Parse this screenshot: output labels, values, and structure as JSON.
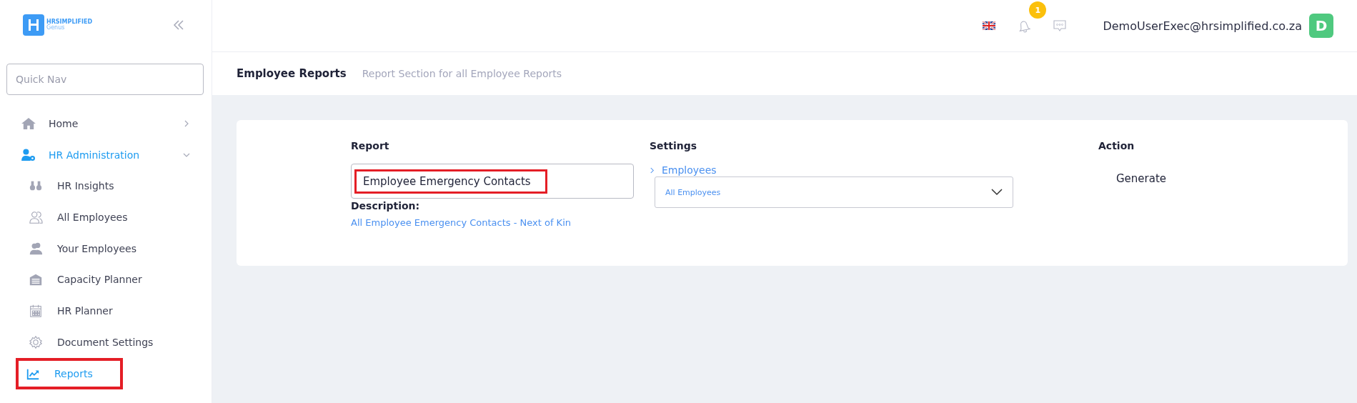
{
  "logo": {
    "brand": "HRSIMPLIFIED",
    "product": "Genus"
  },
  "quick_nav": {
    "placeholder": "Quick Nav"
  },
  "nav": [
    {
      "label": "Home",
      "selected": false,
      "expanded": false,
      "highlighted": false
    },
    {
      "label": "HR Administration",
      "selected": true,
      "expanded": true,
      "highlighted": false,
      "children": [
        {
          "label": "HR Insights",
          "selected": false,
          "highlighted": false
        },
        {
          "label": "All Employees",
          "selected": false,
          "highlighted": false
        },
        {
          "label": "Your Employees",
          "selected": false,
          "highlighted": false
        },
        {
          "label": "Capacity Planner",
          "selected": false,
          "highlighted": false
        },
        {
          "label": "HR Planner",
          "selected": false,
          "highlighted": false
        },
        {
          "label": "Document Settings",
          "selected": false,
          "highlighted": false
        },
        {
          "label": "Reports",
          "selected": true,
          "highlighted": true
        }
      ]
    }
  ],
  "topbar": {
    "notification_count": "1",
    "user_email": "DemoUserExec@hrsimplified.co.za",
    "avatar_letter": "D"
  },
  "page_header": {
    "title": "Employee Reports",
    "subtitle": "Report Section for all Employee Reports"
  },
  "report_form": {
    "report": {
      "heading": "Report",
      "value": "Employee Emergency Contacts",
      "highlighted": true
    },
    "description": {
      "heading": "Description:",
      "text": "All Employee Emergency Contacts - Next of Kin"
    },
    "settings": {
      "heading": "Settings",
      "group": "Employees",
      "select_value": "All Employees"
    },
    "action": {
      "heading": "Action",
      "button": "Generate"
    }
  }
}
